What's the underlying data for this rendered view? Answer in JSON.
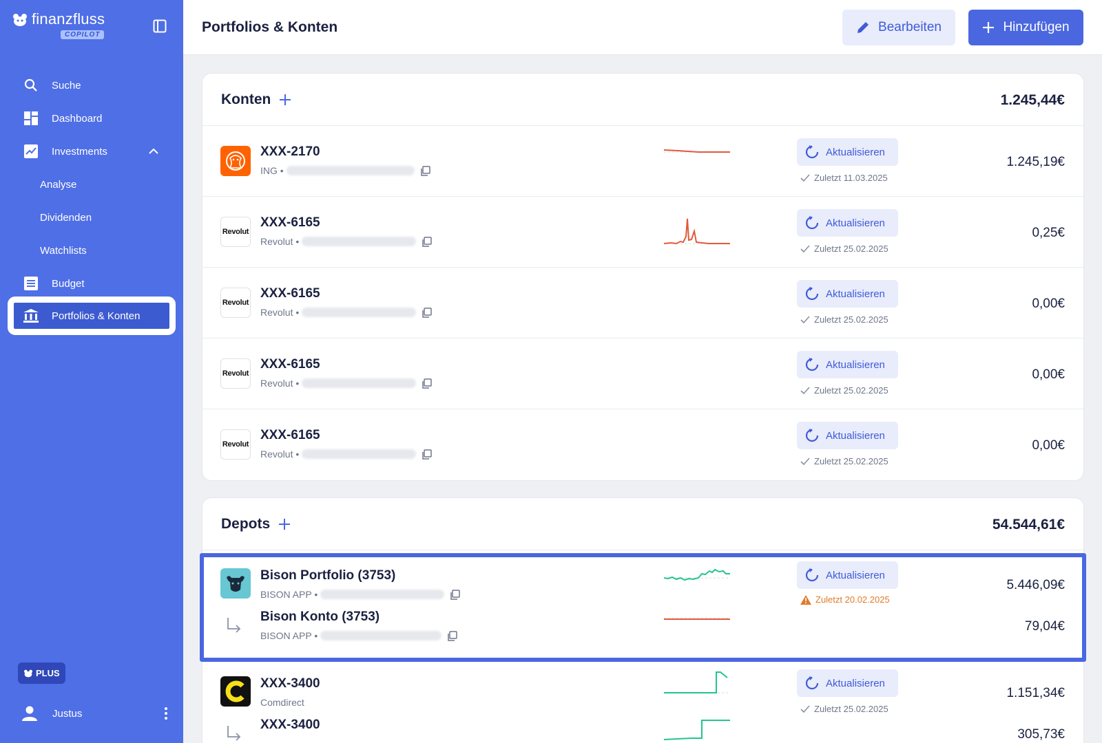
{
  "brand": {
    "name": "finanzfluss",
    "badge": "COPILOT"
  },
  "nav": {
    "search": "Suche",
    "dashboard": "Dashboard",
    "investments": "Investments",
    "analyse": "Analyse",
    "dividenden": "Dividenden",
    "watchlists": "Watchlists",
    "budget": "Budget",
    "portfolios": "Portfolios & Konten"
  },
  "plan_badge": "PLUS",
  "user": {
    "name": "Justus"
  },
  "header": {
    "title": "Portfolios & Konten",
    "edit_label": "Bearbeiten",
    "add_label": "Hinzufügen"
  },
  "colors": {
    "sidebar": "#4f6fe6",
    "accent": "#4a67e0",
    "negative": "#e05a3c",
    "positive": "#22c58b",
    "warning": "#e07b2a"
  },
  "konten": {
    "title": "Konten",
    "total": "1.245,44€",
    "rows": [
      {
        "name": "XXX-2170",
        "provider": "ING •",
        "refresh": "Aktualisieren",
        "updated": "Zuletzt 11.03.2025",
        "amount": "1.245,19€"
      },
      {
        "name": "XXX-6165",
        "provider": "Revolut •",
        "refresh": "Aktualisieren",
        "updated": "Zuletzt 25.02.2025",
        "amount": "0,25€"
      },
      {
        "name": "XXX-6165",
        "provider": "Revolut •",
        "refresh": "Aktualisieren",
        "updated": "Zuletzt 25.02.2025",
        "amount": "0,00€"
      },
      {
        "name": "XXX-6165",
        "provider": "Revolut •",
        "refresh": "Aktualisieren",
        "updated": "Zuletzt 25.02.2025",
        "amount": "0,00€"
      },
      {
        "name": "XXX-6165",
        "provider": "Revolut •",
        "refresh": "Aktualisieren",
        "updated": "Zuletzt 25.02.2025",
        "amount": "0,00€"
      }
    ]
  },
  "depots": {
    "title": "Depots",
    "total": "54.544,61€",
    "rows": [
      {
        "name": "Bison Portfolio (3753)",
        "provider": "BISON APP •",
        "refresh": "Aktualisieren",
        "updated": "Zuletzt 20.02.2025",
        "amount": "5.446,09€",
        "sub_name": "Bison Konto (3753)",
        "sub_provider": "BISON APP •",
        "sub_amount": "79,04€"
      },
      {
        "name": "XXX-3400",
        "provider": "Comdirect",
        "refresh": "Aktualisieren",
        "updated": "Zuletzt 25.02.2025",
        "amount": "1.151,34€",
        "sub_name": "XXX-3400",
        "sub_amount": "305,73€"
      }
    ]
  },
  "logos": {
    "revolut": "Revolut"
  }
}
